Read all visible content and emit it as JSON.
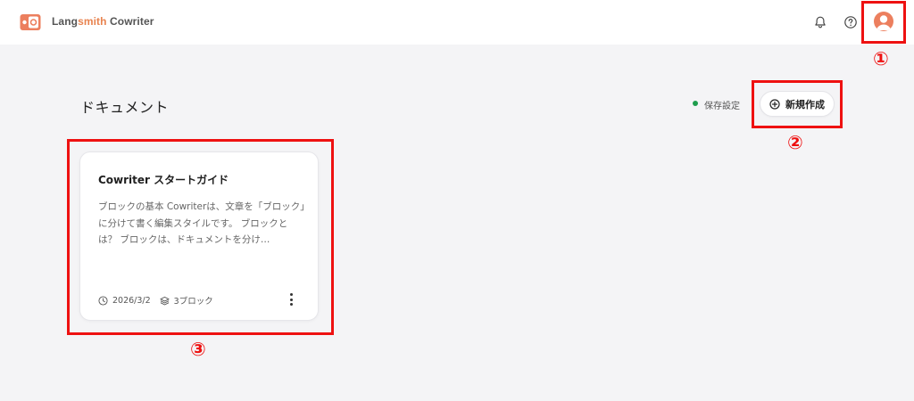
{
  "app": {
    "brand_prefix": "Lang",
    "brand_accent": "smith",
    "brand_suffix": " Cowriter",
    "accent_color": "#e8834f"
  },
  "header": {
    "icons": [
      "notification-bell-icon",
      "help-icon",
      "user-avatar"
    ]
  },
  "main": {
    "title": "ドキュメント",
    "status": {
      "text": "保存設定",
      "color": "#1e9d4d"
    },
    "new_button": {
      "label": "新規作成",
      "icon": "plus-circle-icon"
    }
  },
  "documents": [
    {
      "title": "Cowriter スタートガイド",
      "excerpt": "ブロックの基本 Cowriterは、文章を「ブロック」に分けて書く編集スタイルです。 ブロックとは？ ブロックは、ドキュメントを分け…",
      "date": "2026/3/2",
      "blocks": "3ブロック"
    }
  ],
  "annotations": {
    "one": "①",
    "two": "②",
    "three": "③",
    "color": "#ee1111"
  }
}
